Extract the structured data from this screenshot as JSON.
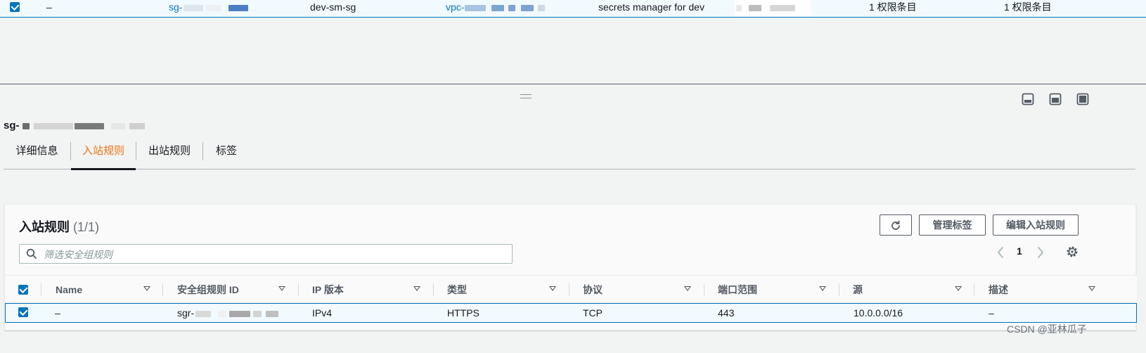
{
  "top_row": {
    "dash": "–",
    "sg_prefix": "sg-",
    "name": "dev-sm-sg",
    "vpc_prefix": "vpc-",
    "description": "secrets manager for dev",
    "inbound_count": "1 权限条目",
    "outbound_count": "1 权限条目"
  },
  "detail": {
    "sg_prefix": "sg-",
    "tabs": [
      {
        "label": "详细信息"
      },
      {
        "label": "入站规则"
      },
      {
        "label": "出站规则"
      },
      {
        "label": "标签"
      }
    ],
    "active_tab": "入站规则"
  },
  "inbound": {
    "title": "入站规则",
    "count": "(1/1)",
    "refresh_icon": "refresh-icon",
    "manage_tags_label": "管理标签",
    "edit_rules_label": "编辑入站规则",
    "search_placeholder": "筛选安全组规则",
    "page": "1",
    "columns": [
      "Name",
      "安全组规则 ID",
      "IP 版本",
      "类型",
      "协议",
      "端口范围",
      "源",
      "描述"
    ],
    "rows": [
      {
        "name": "–",
        "rule_id_prefix": "sgr-",
        "ip_version": "IPv4",
        "type": "HTTPS",
        "protocol": "TCP",
        "port_range": "443",
        "source": "10.0.0.0/16",
        "description": "–"
      }
    ]
  },
  "watermark": "CSDN @亚林瓜子",
  "colors": {
    "accent": "#0073bb",
    "active_tab": "#ec7211",
    "selected_row_bg": "#f1faff"
  }
}
